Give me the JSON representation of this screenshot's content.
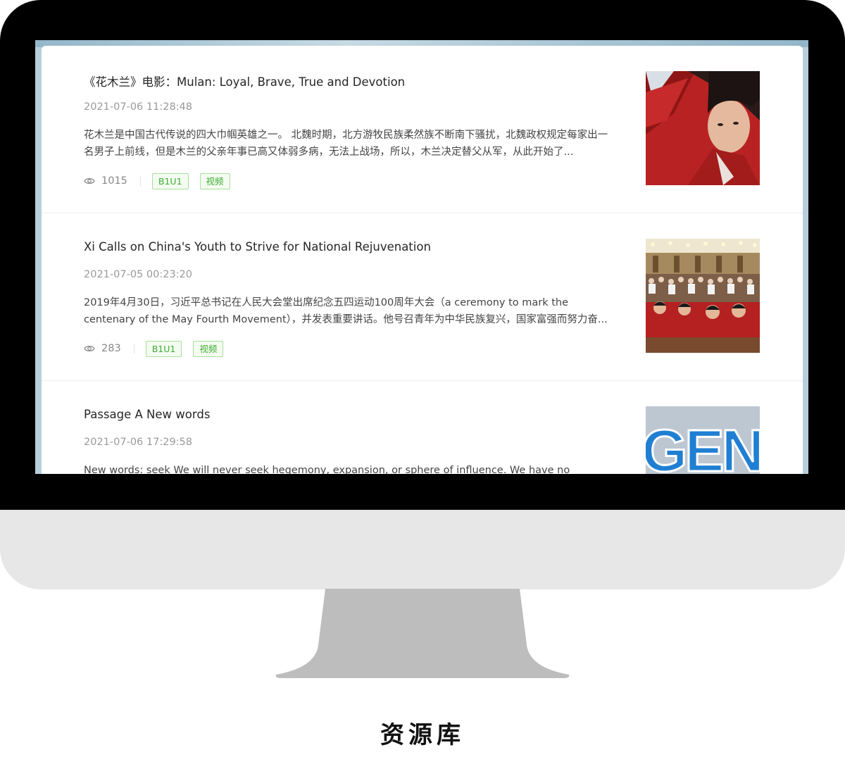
{
  "caption": "资源库",
  "articles": [
    {
      "title": "《花木兰》电影：Mulan: Loyal, Brave, True and Devotion",
      "date": "2021-07-06 11:28:48",
      "excerpt": "花木兰是中国古代传说的四大巾帼英雄之一。 北魏时期，北方游牧民族柔然族不断南下骚扰，北魏政权规定每家出一名男子上前线，但是木兰的父亲年事已高又体弱多病，无法上战场，所以，木兰决定替父从军，从此开始了...",
      "views": "1015",
      "tags": [
        "B1U1",
        "视频"
      ],
      "thumbnail": "mulan-movie-still"
    },
    {
      "title": "Xi Calls on China's Youth to Strive for National Rejuvenation",
      "date": "2021-07-05 00:23:20",
      "excerpt": "2019年4月30日，习近平总书记在人民大会堂出席纪念五四运动100周年大会（a ceremony to mark the centenary of the May Fourth Movement），并发表重要讲话。他号召青年为中华民族复兴，国家富强而努力奋...",
      "views": "283",
      "tags": [
        "B1U1",
        "视频"
      ],
      "thumbnail": "assembly-hall-youth-photo"
    },
    {
      "title": "Passage A New words",
      "date": "2021-07-06 17:29:58",
      "excerpt": "New words: seek We will never seek hegemony, expansion, or sphere of influence. We have no intention to",
      "views": "",
      "tags": [],
      "thumbnail": "gen-logo-photo"
    }
  ],
  "icons": {
    "views": "eye-icon"
  },
  "colors": {
    "tag_green": "#3fae32",
    "tag_border": "#a8e09a",
    "bezel": "#000000",
    "monitor_body": "#e7e7e7",
    "stand": "#bdbdbd"
  }
}
